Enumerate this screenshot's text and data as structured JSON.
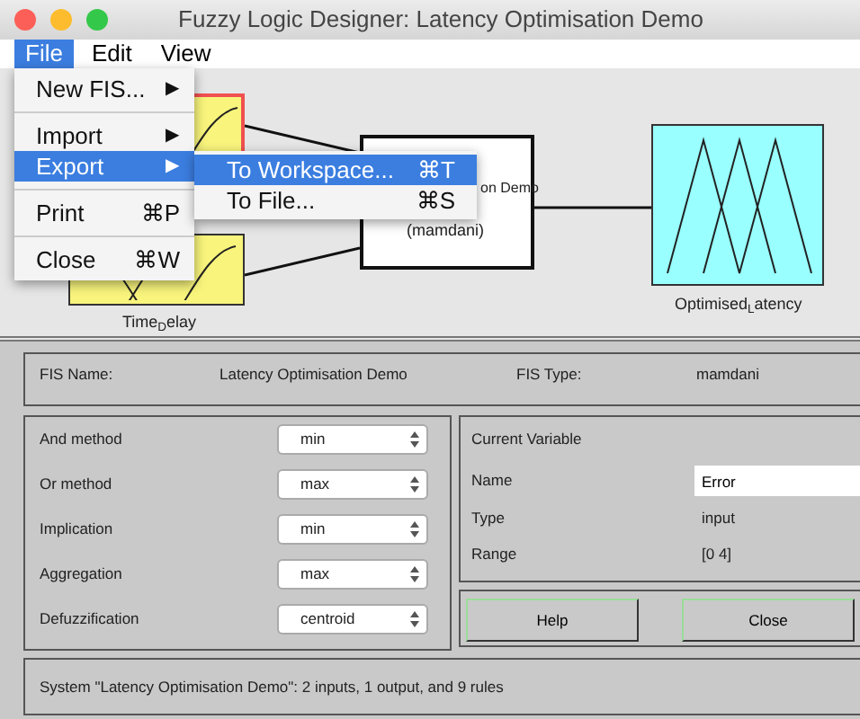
{
  "window": {
    "title": "Fuzzy Logic Designer: Latency Optimisation Demo"
  },
  "menubar": [
    {
      "label": "File",
      "selected": true
    },
    {
      "label": "Edit",
      "selected": false
    },
    {
      "label": "View",
      "selected": false
    }
  ],
  "file_menu": [
    {
      "kind": "item",
      "label": "New FIS...",
      "shortcut": "▶",
      "selected": false
    },
    {
      "kind": "separator"
    },
    {
      "kind": "item",
      "label": "Import",
      "shortcut": "▶",
      "selected": false
    },
    {
      "kind": "item",
      "label": "Export",
      "shortcut": "▶",
      "selected": true
    },
    {
      "kind": "separator"
    },
    {
      "kind": "item",
      "label": "Print",
      "shortcut": "⌘P",
      "selected": false
    },
    {
      "kind": "separator"
    },
    {
      "kind": "item",
      "label": "Close",
      "shortcut": "⌘W",
      "selected": false
    }
  ],
  "export_submenu": [
    {
      "label": "To Workspace...",
      "shortcut": "⌘T",
      "selected": true
    },
    {
      "label": "To File...",
      "shortcut": "⌘S",
      "selected": false
    }
  ],
  "diagram": {
    "inputs": [
      {
        "selected": true
      },
      {
        "label": "Time$_{D}$elay",
        "selected": false
      }
    ],
    "system": {
      "lines": [
        "on Demo",
        "(mamdani)"
      ]
    },
    "output": {
      "label": "Optimised$_{L}$atency"
    }
  },
  "fis_info": {
    "name_label": "FIS Name:",
    "name_value": "Latency Optimisation Demo",
    "type_label": "FIS Type:",
    "type_value": "mamdani"
  },
  "methods": [
    {
      "label": "And method",
      "value": "min"
    },
    {
      "label": "Or method",
      "value": "max"
    },
    {
      "label": "Implication",
      "value": "min"
    },
    {
      "label": "Aggregation",
      "value": "max"
    },
    {
      "label": "Defuzzification",
      "value": "centroid"
    }
  ],
  "current_variable": {
    "title": "Current Variable",
    "fields": [
      {
        "kind": "input",
        "label": "Name",
        "value": "Error"
      },
      {
        "kind": "text",
        "label": "Type",
        "value": "input"
      },
      {
        "kind": "text",
        "label": "Range",
        "value": "[0 4]"
      }
    ]
  },
  "buttons": [
    "Help",
    "Close"
  ],
  "status": "System \"Latency Optimisation Demo\": 2 inputs, 1 output, and 9 rules"
}
